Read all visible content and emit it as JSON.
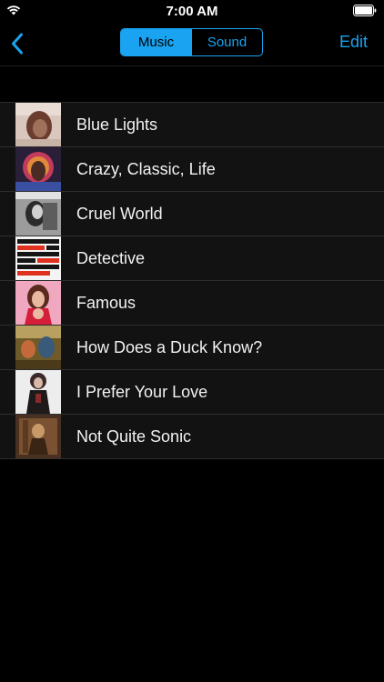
{
  "status_bar": {
    "time": "7:00 AM",
    "wifi_icon": "wifi-icon",
    "battery_icon": "battery-icon"
  },
  "nav": {
    "back_icon": "chevron-left-icon",
    "segments": [
      {
        "label": "Music",
        "selected": true
      },
      {
        "label": "Sound",
        "selected": false
      }
    ],
    "edit_label": "Edit"
  },
  "colors": {
    "accent": "#1aa3f0",
    "background": "#000000",
    "row_background": "#121212"
  },
  "songs": [
    {
      "title": "Blue Lights",
      "art_icon": "album-art"
    },
    {
      "title": "Crazy, Classic, Life",
      "art_icon": "album-art"
    },
    {
      "title": "Cruel World",
      "art_icon": "album-art"
    },
    {
      "title": "Detective",
      "art_icon": "album-art"
    },
    {
      "title": "Famous",
      "art_icon": "album-art"
    },
    {
      "title": "How Does a Duck Know?",
      "art_icon": "album-art"
    },
    {
      "title": "I Prefer Your Love",
      "art_icon": "album-art"
    },
    {
      "title": "Not Quite Sonic",
      "art_icon": "album-art"
    }
  ]
}
